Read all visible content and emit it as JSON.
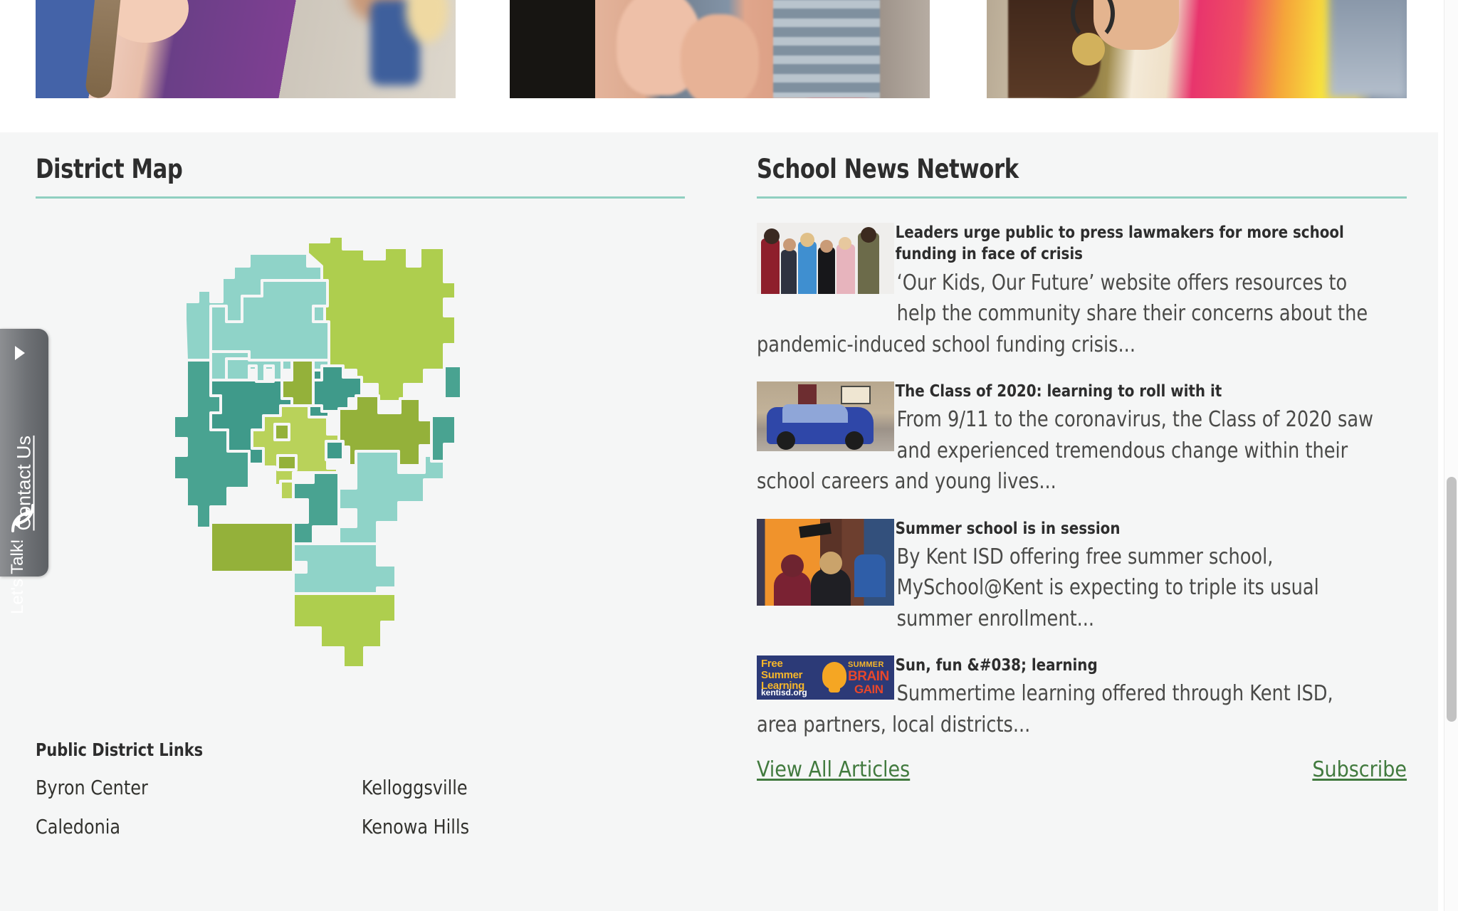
{
  "photo_strip": {
    "photos": [
      {
        "name": "students-classroom-photo",
        "alt": "Teacher smiling with students in classroom"
      },
      {
        "name": "students-clapping-photo",
        "alt": "Students clapping hands together"
      },
      {
        "name": "student-tiedye-photo",
        "alt": "Student in colorful tie-dye shirt"
      }
    ]
  },
  "district_map": {
    "title": "District Map",
    "accent_color": "#8fcfc0",
    "map_colors": {
      "light_teal": "#8fd3c8",
      "mid_teal": "#6fc3b6",
      "dark_teal": "#49a391",
      "deep_teal": "#3f9a8a",
      "light_green": "#a9cc4f",
      "olive_green": "#94b13a",
      "yellow_green": "#b9d25a"
    }
  },
  "public_district_links": {
    "heading": "Public District Links",
    "columns": [
      [
        "Byron Center",
        "Caledonia"
      ],
      [
        "Kelloggsville",
        "Kenowa Hills"
      ]
    ]
  },
  "lets_talk": {
    "brand": "Let's Talk!",
    "label": "Contact Us",
    "arrow_icon": "play-triangle-icon"
  },
  "school_news": {
    "title": "School News Network",
    "accent_color": "#8fcfc0",
    "link_color": "#417a3e",
    "articles": [
      {
        "headline": "Leaders urge public to press lawmakers for more school funding in face of crisis",
        "excerpt": "‘Our Kids, Our Future’ website offers resources to help the community share their concerns about the pandemic-induced school funding crisis...",
        "thumb_name": "article-thumb-children-group"
      },
      {
        "headline": "The Class of 2020: learning to roll with it",
        "excerpt": "From 9/11 to the coronavirus, the Class of 2020 saw and experienced tremendous change within their school careers and young lives...",
        "thumb_name": "article-thumb-decorated-car-parade"
      },
      {
        "headline": "Summer school is in session",
        "excerpt": "By Kent ISD offering free summer school, MySchool@Kent is expecting to triple its usual summer enrollment...",
        "thumb_name": "article-thumb-myschool-kent"
      },
      {
        "headline": "Sun, fun &#038; learning",
        "excerpt": "Summertime learning offered through Kent ISD, area partners, local districts...",
        "thumb_name": "article-thumb-free-summer-learning-banner",
        "thumb_text": {
          "line1": "Free",
          "line2": "Summer",
          "line3": "Learning",
          "url": "kentisd.org",
          "badge_top": "SUMMER",
          "badge_mid": "BRAIN",
          "badge_bottom": "GAIN"
        }
      }
    ],
    "view_all_label": "View All Articles",
    "subscribe_label": "Subscribe"
  }
}
